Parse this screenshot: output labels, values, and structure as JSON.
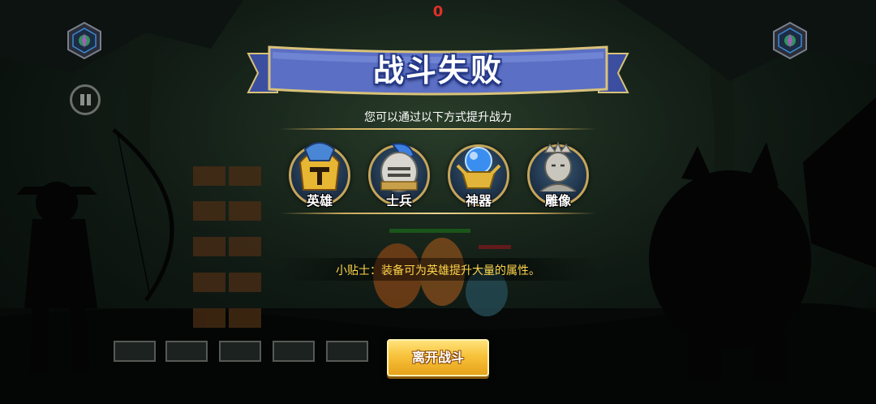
{
  "hud": {
    "score": "0",
    "left_gem_icon": "rune-gem-icon",
    "right_gem_icon": "rune-gem-icon",
    "pause_icon": "pause-icon"
  },
  "dialog": {
    "title": "战斗失败",
    "subtitle": "您可以通过以下方式提升战力",
    "options": [
      {
        "label": "英雄",
        "icon": "hero-helmet-icon"
      },
      {
        "label": "士兵",
        "icon": "soldier-helmet-icon"
      },
      {
        "label": "神器",
        "icon": "artifact-orb-icon"
      },
      {
        "label": "雕像",
        "icon": "statue-icon"
      }
    ],
    "tip": "小贴士：装备可为英雄提升大量的属性。",
    "leave_button": "离开战斗"
  },
  "colors": {
    "banner": "#5b6fc4",
    "banner_edge": "#d9c27a",
    "score": "#e0302a",
    "tip_text": "#ffd54a",
    "button": "#f7c23a"
  }
}
